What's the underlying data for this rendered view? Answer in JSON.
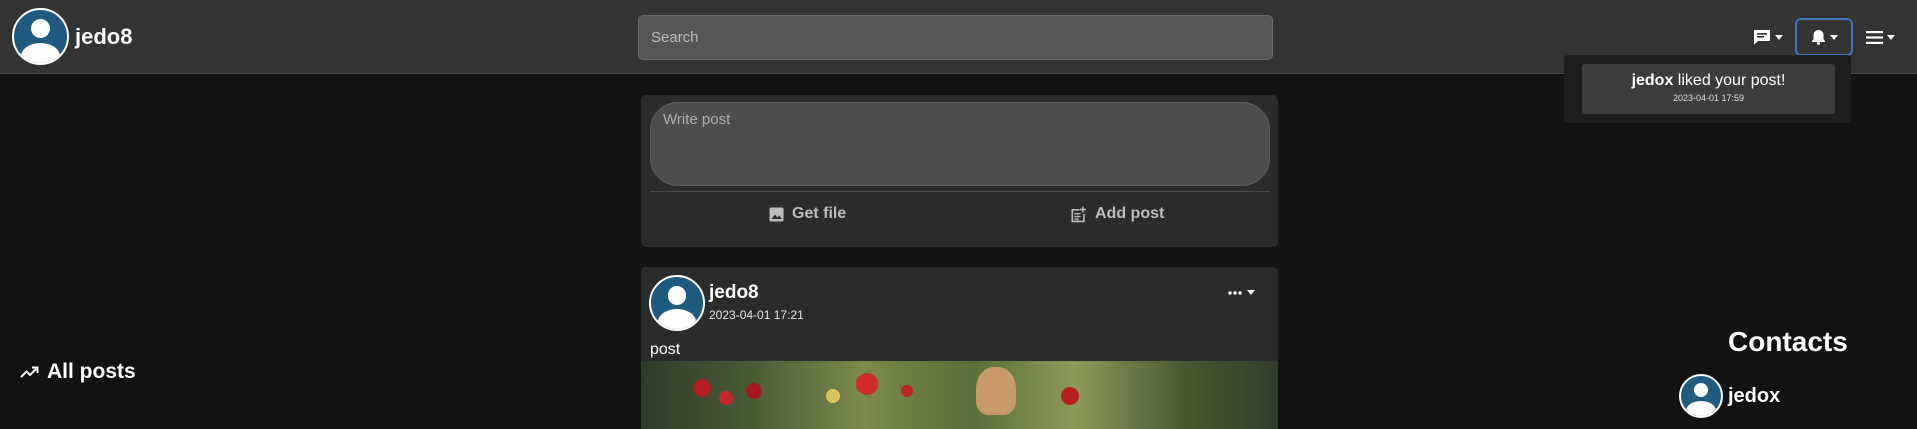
{
  "navbar": {
    "username": "jedo8",
    "search_placeholder": "Search",
    "messages_icon": "chat-bubble-icon",
    "notifications_icon": "bell-icon",
    "menu_icon": "hamburger-icon"
  },
  "notifications": {
    "items": [
      {
        "user": "jedox",
        "text": " liked your post!",
        "time": "2023-04-01 17:59"
      }
    ]
  },
  "composer": {
    "placeholder": "Write post",
    "get_file_label": "Get file",
    "add_post_label": "Add post"
  },
  "posts": [
    {
      "author": "jedo8",
      "time": "2023-04-01 17:21",
      "text": "post"
    }
  ],
  "sidebar": {
    "all_posts_label": "All posts"
  },
  "contacts": {
    "title": "Contacts",
    "items": [
      {
        "name": "jedox"
      }
    ]
  },
  "colors": {
    "navbar": "#333333",
    "background": "#121212",
    "card": "#2b2b2b",
    "avatar": "#1f5a80",
    "accent_border": "#3b76c4"
  }
}
